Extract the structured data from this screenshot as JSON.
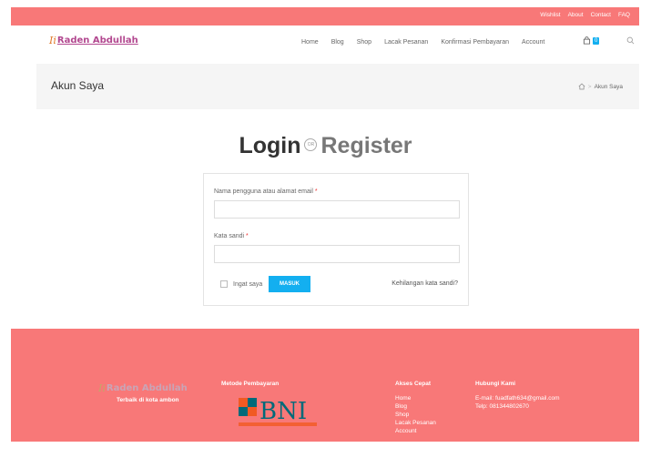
{
  "topbar": {
    "links": [
      "Wishlist",
      "About",
      "Contact",
      "FAQ"
    ]
  },
  "header": {
    "logo_mark": "Ii",
    "logo_text": "Raden Abdullah",
    "nav": [
      "Home",
      "Blog",
      "Shop",
      "Lacak Pesanan",
      "Konfirmasi Pembayaran",
      "Account"
    ],
    "cart_count": "0"
  },
  "page_header": {
    "title": "Akun Saya",
    "breadcrumb_current": "Akun Saya",
    "breadcrumb_sep": ">"
  },
  "auth": {
    "login": "Login",
    "or": "OR",
    "register": "Register"
  },
  "form": {
    "username_label": "Nama pengguna atau alamat email",
    "password_label": "Kata sandi",
    "required_mark": "*",
    "username_value": "",
    "password_value": "",
    "remember_label": "Ingat saya",
    "submit_label": "MASUK",
    "lost_password": "Kehilangan kata sandi?"
  },
  "footer": {
    "logo_mark": "Ii",
    "logo_text": "Raden Abdullah",
    "tagline": "Terbaik di kota ambon",
    "payment_title": "Metode Pembayaran",
    "bank_name": "BNI",
    "quick_title": "Akses Cepat",
    "quick_links": [
      "Home",
      "Blog",
      "Shop",
      "Lacak Pesanan",
      "Account"
    ],
    "contact_title": "Hubungi Kami",
    "email": "E-mail: fuadfath634@gmail.com",
    "phone": "Telp: 081344802670"
  },
  "colors": {
    "accent": "#f87878",
    "button": "#13aff0",
    "logo_text": "#b2478f",
    "bni_orange": "#f15a22",
    "bni_teal": "#006a7a"
  }
}
